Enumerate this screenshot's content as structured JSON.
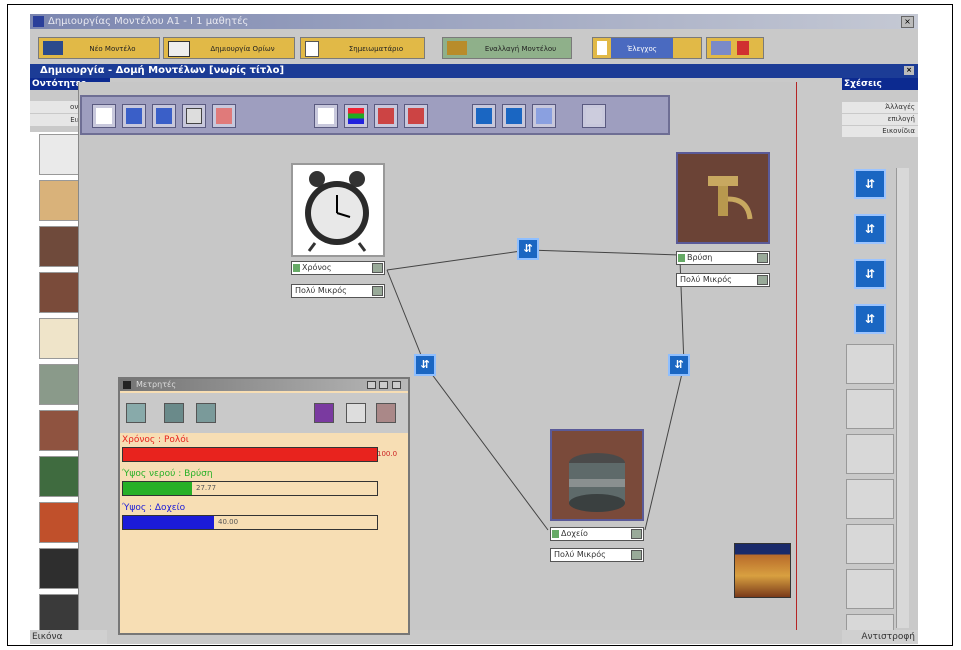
{
  "window": {
    "title": "Δημιουργίας Μοντέλου  Α1 - Ι 1 μαθητές"
  },
  "main_toolbar": [
    {
      "label": "Νέο Μοντέλο"
    },
    {
      "label": "Δημιουργία Ορίων Μοντέλου"
    },
    {
      "label": "Σημειωματάριο"
    },
    {
      "label": "Εναλλαγή Μοντέλου"
    },
    {
      "label": "Έλεγχος"
    },
    {
      "label": ""
    }
  ],
  "child_window": {
    "title": "Δημιουργία - Δομή Μοντέλων [νωρίς τίτλο]"
  },
  "left_panel": {
    "header": "Οντότητες",
    "sub1": "ονομασία",
    "sub2": "Εικονίδια",
    "footer": "Εικόνα",
    "thumbnails": [
      {
        "name": "alarm-clock-thumbnail",
        "color": "#eaeaea"
      },
      {
        "name": "calendar-thumbnail",
        "color": "#d9b27a"
      },
      {
        "name": "pot-thumbnail",
        "color": "#6f4a3b"
      },
      {
        "name": "faucet-thumbnail",
        "color": "#7a4b3a"
      },
      {
        "name": "character-thumbnail",
        "color": "#efe4c9"
      },
      {
        "name": "car-thumbnail",
        "color": "#8a9a8a"
      },
      {
        "name": "brick-thumbnail",
        "color": "#8f5340"
      },
      {
        "name": "plant-thumbnail",
        "color": "#3f6b3f"
      },
      {
        "name": "ball-thumbnail",
        "color": "#c0502b"
      },
      {
        "name": "traffic-light-thumbnail",
        "color": "#2e2e2e"
      },
      {
        "name": "traffic-light-2-thumbnail",
        "color": "#3a3a3a"
      }
    ]
  },
  "right_panel": {
    "header": "Σχέσεις",
    "sub1": "Άλλαγές",
    "sub2": "επιλογή",
    "sub3": "Εικονίδια",
    "footer": "Αντιστροφή",
    "icons": [
      "relation-icon-1",
      "relation-icon-2",
      "relation-icon-3",
      "relation-icon-4"
    ],
    "empty_slots": 7
  },
  "nodes": [
    {
      "name": "alarm-clock",
      "field": "Χρόνος",
      "select": "Πολύ Μικρός"
    },
    {
      "name": "faucet",
      "field": "Βρύση",
      "select": "Πολύ Μικρός"
    },
    {
      "name": "pot",
      "field": "Δοχείο",
      "select": "Πολύ Μικρός"
    }
  ],
  "meters_dialog": {
    "title": "Μετρητές",
    "meters": [
      {
        "label": "Χρόνος : Ρολόι",
        "value": 1,
        "value_text": "100.0",
        "color": "#e8231e"
      },
      {
        "label": "Ύψος νερού : Βρύση",
        "value": 0.27,
        "value_text": "27.77",
        "color": "#27b027"
      },
      {
        "label": "Ύψος : Δοχείο",
        "value": 0.36,
        "value_text": "40.00",
        "color": "#1b1bd8"
      }
    ]
  },
  "colors": {
    "title_active": "#1c3c96",
    "canvas": "#c7c7c7",
    "dialog": "#f7deb4",
    "relation_icon": "#1a66c2"
  }
}
